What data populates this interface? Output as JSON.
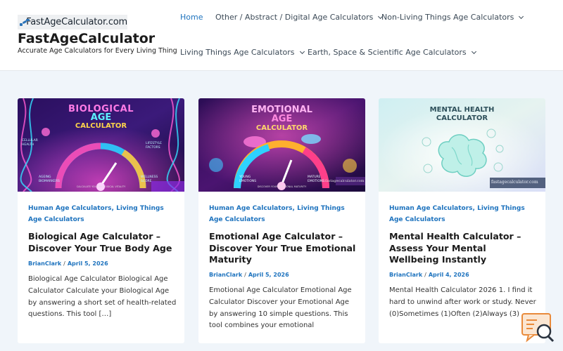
{
  "header": {
    "logo_text": "FastAgeCalculator.com",
    "site_title": "FastAgeCalculator",
    "tagline": "Accurate Age Calculators for Every Living Thing"
  },
  "nav": {
    "items": [
      {
        "label": "Home",
        "active": true
      },
      {
        "label": "Other / Abstract / Digital Age Calculators",
        "dropdown": true
      },
      {
        "label": "Non-Living Things Age Calculators",
        "dropdown": true
      },
      {
        "label": "Living Things Age Calculators",
        "dropdown": true
      },
      {
        "label": "Earth, Space & Scientific Age Calculators",
        "dropdown": true
      }
    ]
  },
  "cards": [
    {
      "image": {
        "line1": "BIOLOGICAL",
        "line2": "AGE",
        "line3": "CALCULATOR",
        "labels": [
          "CELLULAR HEALTH",
          "LIFESTYLE FACTORS",
          "AGEING BIOMARKERS",
          "WELLNESS SCORE"
        ],
        "footer": "CALCULATE YOUR BIOLOGICAL VITALITY"
      },
      "categories": [
        "Human Age Calculators",
        "Living Things Age Calculators"
      ],
      "title": "Biological Age Calculator – Discover Your True Body Age",
      "author": "BrianClark",
      "date": "April 5, 2026",
      "excerpt": "Biological Age Calculator Biological Age Calculator Calculate your Biological Age by answering a short set of health-related questions. This tool […]"
    },
    {
      "image": {
        "line1": "EMOTIONAL",
        "line2": "AGE",
        "line3": "CALCULATOR",
        "labels": [
          "YOUNG EMOTIONS",
          "MATURE EMOTIONS"
        ],
        "footer": "DISCOVER YOUR EMOTIONAL MATURITY",
        "watermark": "fastagecalculator.com"
      },
      "categories": [
        "Human Age Calculators",
        "Living Things Age Calculators"
      ],
      "title": "Emotional Age Calculator – Discover Your True Emotional Maturity",
      "author": "BrianClark",
      "date": "April 5, 2026",
      "excerpt": "Emotional Age Calculator Emotional Age Calculator Discover your Emotional Age by answering 10 simple questions. This tool combines your emotional"
    },
    {
      "image": {
        "line1": "MENTAL HEALTH",
        "line2": "CALCULATOR",
        "watermark": "fastagecalculator.com"
      },
      "categories": [
        "Human Age Calculators",
        "Living Things Age Calculators"
      ],
      "title": "Mental Health Calculator – Assess Your Mental Wellbeing Instantly",
      "author": "BrianClark",
      "date": "April 4, 2026",
      "excerpt": "Mental Health Calculator 2026 1. I find it hard to unwind after work or study. Never (0)Sometimes (1)Often (2)Always (3)"
    }
  ],
  "colors": {
    "accent": "#1e73be",
    "background": "#f0f5fa",
    "chat": "#e98a3a"
  },
  "icons": {
    "chat": "chat-search-icon",
    "chevron": "chevron-down-icon"
  }
}
